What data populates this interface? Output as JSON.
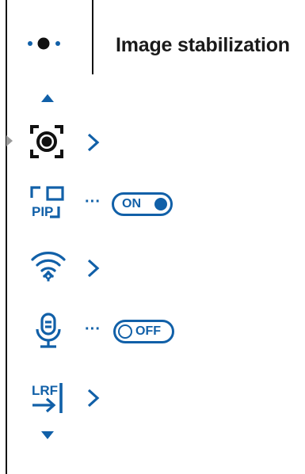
{
  "header": {
    "title": "Image stabilization",
    "page_indicator_icon": "page-dots-icon"
  },
  "colors": {
    "accent": "#1160a8",
    "text": "#1a1a1a",
    "divider": "#111111",
    "selection_marker": "#9a9a9a"
  },
  "menu": {
    "scroll_up_icon": "triangle-up-icon",
    "scroll_down_icon": "triangle-down-icon",
    "items": [
      {
        "icon": "image-stabilization-icon",
        "control": "submenu",
        "selected": true
      },
      {
        "icon": "pip-icon",
        "text": "PIP",
        "control": "toggle",
        "toggle_label": "ON",
        "state": "on"
      },
      {
        "icon": "wifi-settings-icon",
        "control": "submenu"
      },
      {
        "icon": "microphone-icon",
        "control": "toggle",
        "toggle_label": "OFF",
        "state": "off"
      },
      {
        "icon": "lrf-icon",
        "text": "LRF",
        "control": "submenu"
      }
    ]
  }
}
